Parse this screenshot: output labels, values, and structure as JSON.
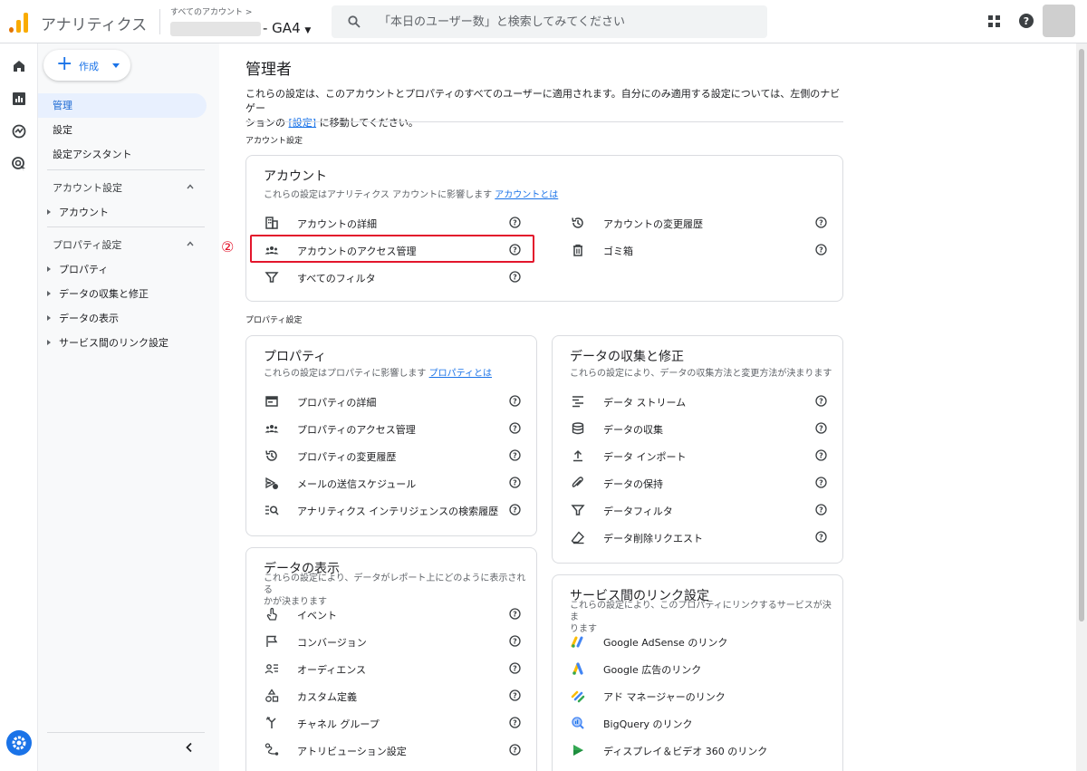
{
  "header": {
    "app_title": "アナリティクス",
    "account_crumb": "すべてのアカウント >",
    "property_suffix": "- GA4",
    "search_placeholder": "「本日のユーザー数」と検索してみてください"
  },
  "sidebar": {
    "create_label": "作成",
    "items": [
      {
        "label": "管理"
      },
      {
        "label": "設定"
      },
      {
        "label": "設定アシスタント"
      }
    ],
    "account_group": "アカウント設定",
    "account_items": [
      "アカウント"
    ],
    "property_group": "プロパティ設定",
    "property_items": [
      "プロパティ",
      "データの収集と修正",
      "データの表示",
      "サービス間のリンク設定"
    ]
  },
  "main": {
    "title": "管理者",
    "description_1": "これらの設定は、このアカウントとプロパティのすべてのユーザーに適用されます。自分にのみ適用する設定については、左側のナビゲー",
    "description_2a": "ションの ",
    "description_link": "[設定]",
    "description_2b": " に移動してください。",
    "account_section": "アカウント設定",
    "property_section": "プロパティ設定",
    "marker": "②"
  },
  "cards": {
    "account": {
      "title": "アカウント",
      "subtitle": "これらの設定はアナリティクス アカウントに影響します ",
      "subtitle_link": "アカウントとは",
      "left": [
        "アカウントの詳細",
        "アカウントのアクセス管理",
        "すべてのフィルタ"
      ],
      "right": [
        "アカウントの変更履歴",
        "ゴミ箱"
      ]
    },
    "property": {
      "title": "プロパティ",
      "subtitle": "これらの設定はプロパティに影響します ",
      "subtitle_link": "プロパティとは",
      "items": [
        "プロパティの詳細",
        "プロパティのアクセス管理",
        "プロパティの変更履歴",
        "メールの送信スケジュール",
        "アナリティクス インテリジェンスの検索履歴"
      ]
    },
    "data_collection": {
      "title": "データの収集と修正",
      "subtitle": "これらの設定により、データの収集方法と変更方法が決まります",
      "items": [
        "データ ストリーム",
        "データの収集",
        "データ インポート",
        "データの保持",
        "データフィルタ",
        "データ削除リクエスト"
      ]
    },
    "data_display": {
      "title": "データの表示",
      "subtitle_1": "これらの設定により、データがレポート上にどのように表示される",
      "subtitle_2": "かが決まります",
      "items": [
        "イベント",
        "コンバージョン",
        "オーディエンス",
        "カスタム定義",
        "チャネル グループ",
        "アトリビューション設定"
      ]
    },
    "product_links": {
      "title": "サービス間のリンク設定",
      "subtitle_1": "これらの設定により、このプロパティにリンクするサービスが決ま",
      "subtitle_2": "ります",
      "items": [
        "Google AdSense のリンク",
        "Google 広告のリンク",
        "アド マネージャーのリンク",
        "BigQuery のリンク",
        "ディスプレイ＆ビデオ 360 のリンク"
      ]
    }
  },
  "colors": {
    "accent": "#1a73e8",
    "highlight": "#e3162c",
    "active_bg": "#e8f0fe",
    "logo_orange": "#f9ab00",
    "logo_dark_orange": "#e37400"
  }
}
